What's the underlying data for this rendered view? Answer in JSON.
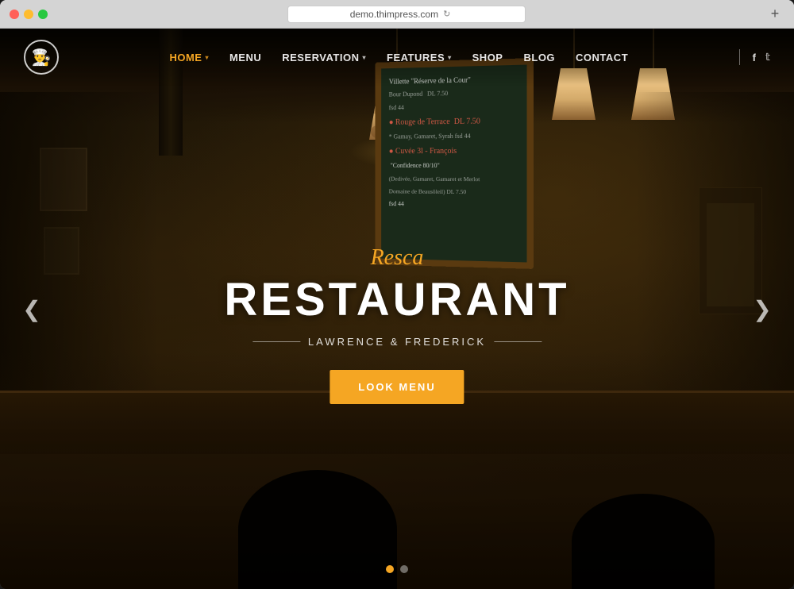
{
  "browser": {
    "url": "demo.thimpress.com",
    "new_tab_label": "+"
  },
  "nav": {
    "logo_icon": "🍳",
    "items": [
      {
        "label": "HOME",
        "active": true,
        "has_dropdown": true
      },
      {
        "label": "MENU",
        "active": false,
        "has_dropdown": false
      },
      {
        "label": "RESERVATION",
        "active": false,
        "has_dropdown": true
      },
      {
        "label": "FEATURES",
        "active": false,
        "has_dropdown": true
      },
      {
        "label": "SHOP",
        "active": false,
        "has_dropdown": false
      },
      {
        "label": "BLOG",
        "active": false,
        "has_dropdown": false
      },
      {
        "label": "CONTACT",
        "active": false,
        "has_dropdown": false
      }
    ],
    "social": [
      {
        "icon": "f",
        "name": "facebook"
      },
      {
        "icon": "t",
        "name": "twitter"
      }
    ]
  },
  "hero": {
    "subtitle": "Resca",
    "title": "RESTAURANT",
    "tagline": "LAWRENCE & FREDERICK",
    "cta_label": "LOOK MENU",
    "arrow_left": "❮",
    "arrow_right": "❯"
  },
  "slider": {
    "dots": [
      {
        "active": true
      },
      {
        "active": false
      }
    ]
  },
  "chalkboard": {
    "lines": [
      "Villette \"Réserve de la Cour\"",
      "Bour Dupond DL 7.50",
      "fsd 44",
      "● Rouge de Terrace DL 7.50",
      "* Gamay, Gamaret, Syrah fsd 44",
      "● Cuvée 3l - François",
      "\"Confidence 80/10\"",
      "(Dedivée, Gamaret, Gamaret et Merlot",
      "Domaine de Beausôleil) DL 7.50",
      "fsd 44"
    ]
  },
  "colors": {
    "accent": "#f5a623",
    "dark_bg": "#1a0f02",
    "nav_active": "#f5a623",
    "nav_inactive": "rgba(255,255,255,0.9)",
    "cta_bg": "#f5a623",
    "dot_active": "#f5a623",
    "dot_inactive": "rgba(255,255,255,0.4)"
  }
}
